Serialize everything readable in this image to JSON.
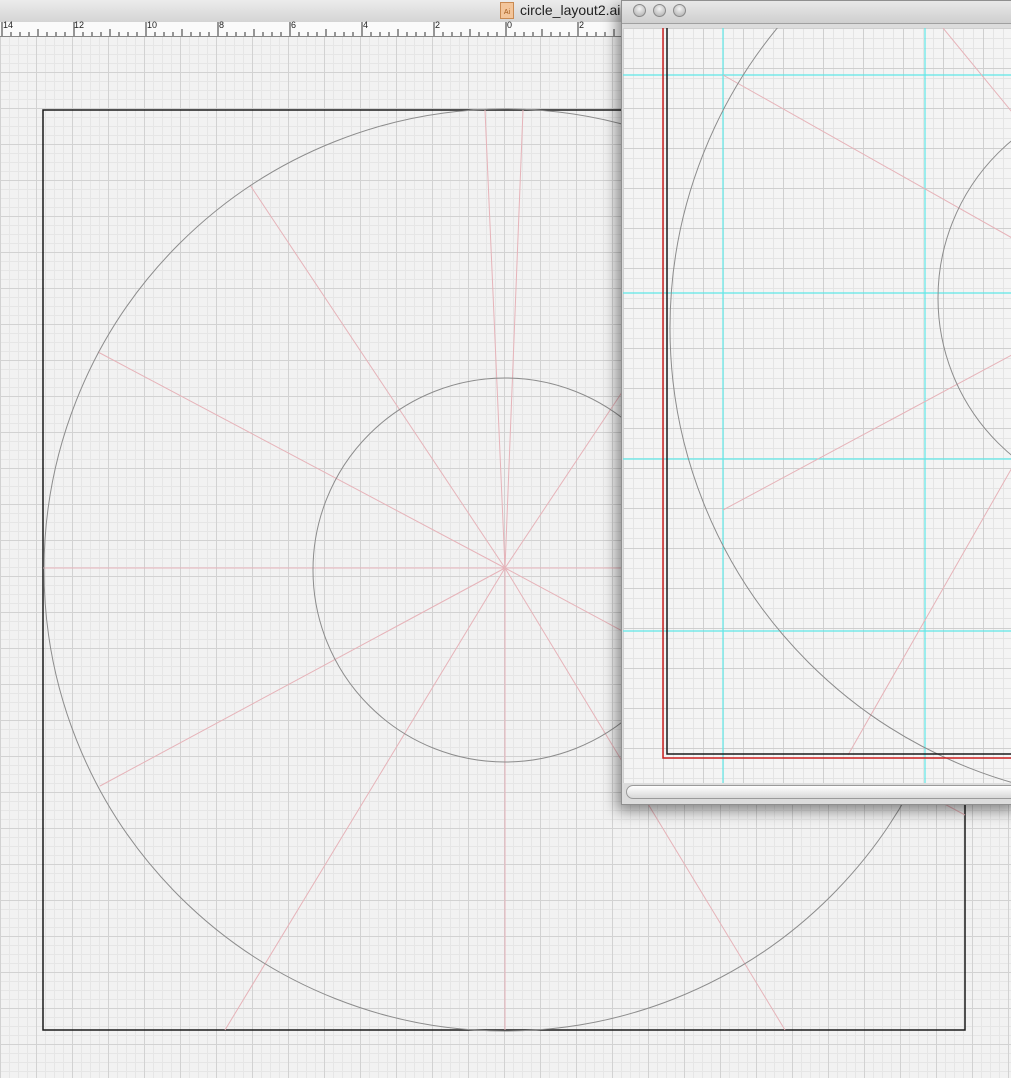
{
  "window": {
    "title": "circle_layout2.ai",
    "doc_icon_label": "Ai"
  },
  "ruler": {
    "labels": [
      "14",
      "12",
      "10",
      "8",
      "6",
      "4",
      "2",
      "0",
      "2"
    ]
  },
  "second_window": {
    "close_button": "",
    "minimize_button": "",
    "zoom_button": ""
  },
  "colors": {
    "guide_pink": "#e6b3b9",
    "circle_gray": "#8c8c8c",
    "guide_cyan": "#5ee8e8",
    "bleed_red": "#cc2020"
  }
}
